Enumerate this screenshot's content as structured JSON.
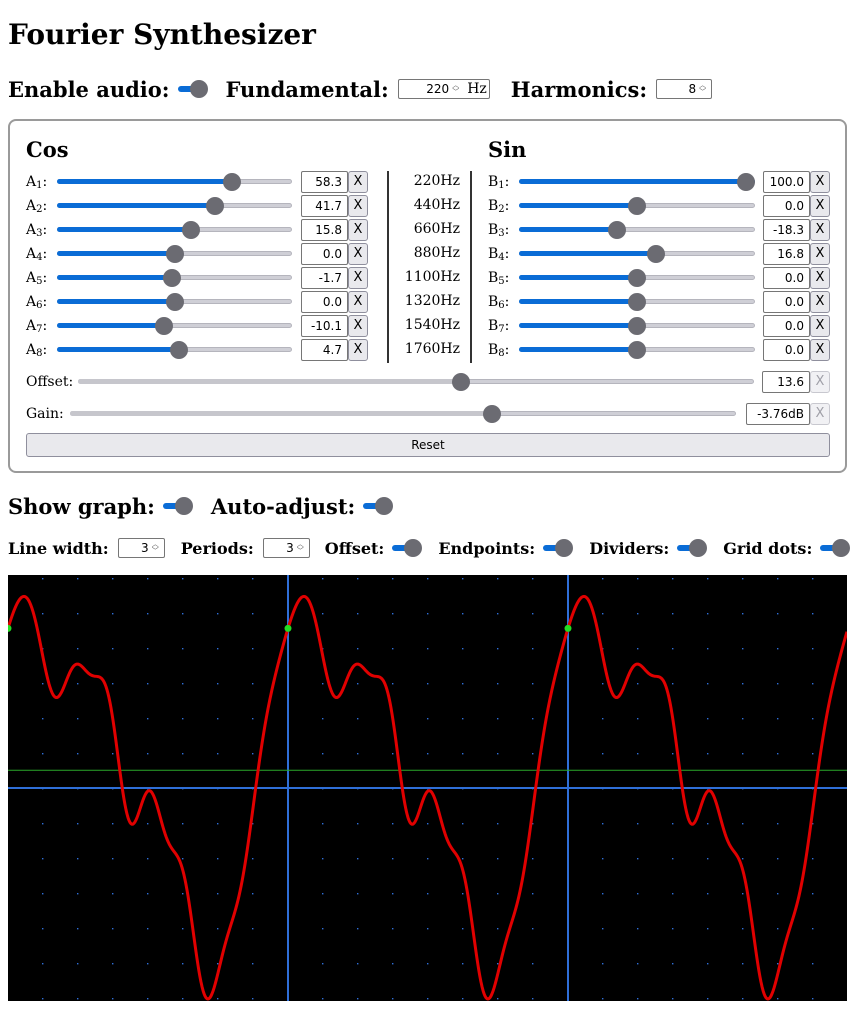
{
  "app": {
    "title": "Fourier Synthesizer"
  },
  "controls": {
    "enable_audio_label": "Enable audio:",
    "fundamental_label": "Fundamental:",
    "fundamental_value": "220",
    "fundamental_unit": "Hz",
    "harmonics_label": "Harmonics:",
    "harmonics_value": "8"
  },
  "panel": {
    "cos_title": "Cos",
    "sin_title": "Sin",
    "clear_label": "X",
    "cos_rows": [
      {
        "name": "A",
        "index": "1",
        "value": "58.3",
        "pos": 0.765
      },
      {
        "name": "A",
        "index": "2",
        "value": "41.7",
        "pos": 0.685
      },
      {
        "name": "A",
        "index": "3",
        "value": "15.8",
        "pos": 0.575
      },
      {
        "name": "A",
        "index": "4",
        "value": "0.0",
        "pos": 0.5
      },
      {
        "name": "A",
        "index": "5",
        "value": "-1.7",
        "pos": 0.49
      },
      {
        "name": "A",
        "index": "6",
        "value": "0.0",
        "pos": 0.5
      },
      {
        "name": "A",
        "index": "7",
        "value": "-10.1",
        "pos": 0.45
      },
      {
        "name": "A",
        "index": "8",
        "value": "4.7",
        "pos": 0.52
      }
    ],
    "frequencies": [
      "220Hz",
      "440Hz",
      "660Hz",
      "880Hz",
      "1100Hz",
      "1320Hz",
      "1540Hz",
      "1760Hz"
    ],
    "sin_rows": [
      {
        "name": "B",
        "index": "1",
        "value": "100.0",
        "pos": 1.0
      },
      {
        "name": "B",
        "index": "2",
        "value": "0.0",
        "pos": 0.5
      },
      {
        "name": "B",
        "index": "3",
        "value": "-18.3",
        "pos": 0.41
      },
      {
        "name": "B",
        "index": "4",
        "value": "16.8",
        "pos": 0.585
      },
      {
        "name": "B",
        "index": "5",
        "value": "0.0",
        "pos": 0.5
      },
      {
        "name": "B",
        "index": "6",
        "value": "0.0",
        "pos": 0.5
      },
      {
        "name": "B",
        "index": "7",
        "value": "0.0",
        "pos": 0.5
      },
      {
        "name": "B",
        "index": "8",
        "value": "0.0",
        "pos": 0.5
      }
    ],
    "offset_label": "Offset:",
    "offset_value": "13.6",
    "offset_pos": 0.568,
    "gain_label": "Gain:",
    "gain_value": "-3.76dB",
    "gain_pos": 0.637,
    "reset_label": "Reset"
  },
  "graph_controls": {
    "show_graph_label": "Show graph:",
    "auto_adjust_label": "Auto-adjust:",
    "line_width_label": "Line width:",
    "line_width_value": "3",
    "periods_label": "Periods:",
    "periods_value": "3",
    "offset_label": "Offset:",
    "endpoints_label": "Endpoints:",
    "dividers_label": "Dividers:",
    "grid_dots_label": "Grid dots:"
  },
  "colors": {
    "accent": "#0a6cd6",
    "waveform": "#e00000",
    "axis": "#2f6fd8",
    "offset_line": "#2aa82a",
    "endpoint": "#22dd22",
    "background": "#000000"
  }
}
